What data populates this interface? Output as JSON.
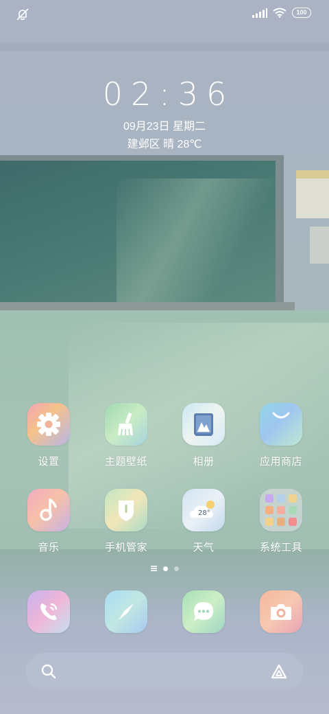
{
  "status_bar": {
    "left_icon": "notifications-muted-icon",
    "signal_icon": "signal-icon",
    "wifi_icon": "wifi-icon",
    "battery": "100"
  },
  "lockclock": {
    "time": "02:36",
    "date": "09月23日 星期二",
    "weather": "建邺区 晴 28℃"
  },
  "apps": [
    {
      "label": "设置",
      "icon": "settings-icon"
    },
    {
      "label": "主题壁纸",
      "icon": "brush-icon"
    },
    {
      "label": "相册",
      "icon": "gallery-icon"
    },
    {
      "label": "应用商店",
      "icon": "shopping-bag-icon"
    },
    {
      "label": "音乐",
      "icon": "music-note-icon"
    },
    {
      "label": "手机管家",
      "icon": "shield-icon"
    },
    {
      "label": "天气",
      "icon": "weather-icon",
      "temp": "28°"
    },
    {
      "label": "系统工具",
      "icon": "folder-icon"
    }
  ],
  "dock": [
    {
      "icon": "phone-icon"
    },
    {
      "icon": "compass-icon"
    },
    {
      "icon": "message-icon"
    },
    {
      "icon": "camera-icon"
    }
  ],
  "pager": {
    "current_page": 1,
    "pages": 2
  },
  "search": {
    "icon": "search-icon",
    "assistant_icon": "assistant-icon"
  },
  "colors": {
    "text": "#ffffff",
    "search_bg": "#b9c0d2"
  }
}
